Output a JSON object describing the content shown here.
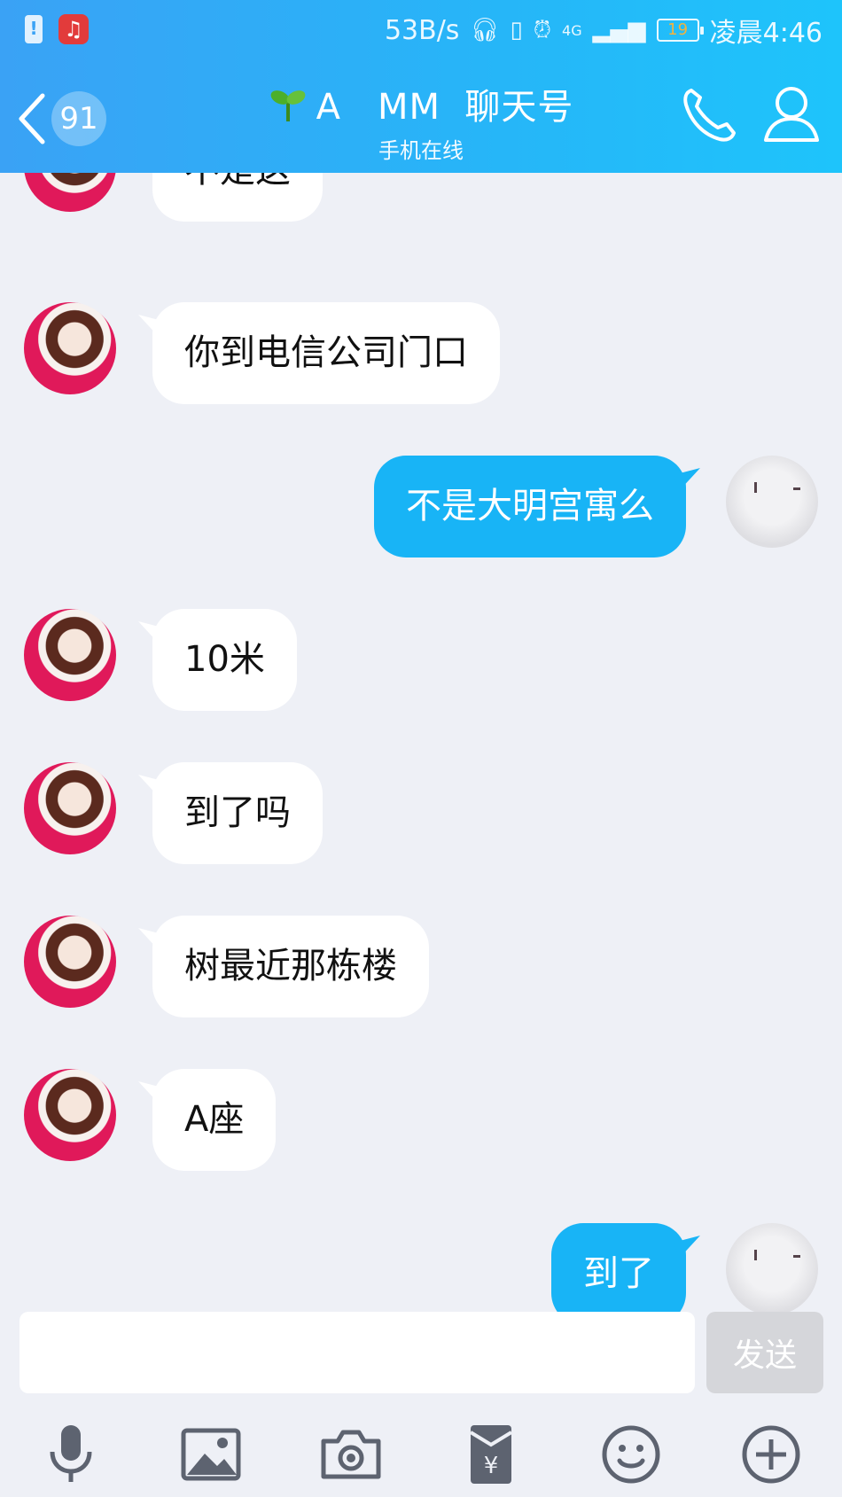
{
  "status_bar": {
    "net_speed": "53B/s",
    "signal_label": "4G",
    "battery_level": "19",
    "time": "凌晨4:46"
  },
  "nav": {
    "unread_count": "91",
    "title": "A　MM  聊天号",
    "subtitle": "手机在线"
  },
  "messages": [
    {
      "side": "in",
      "text": "不是这"
    },
    {
      "side": "in",
      "text": "你到电信公司门口"
    },
    {
      "side": "out",
      "text": "不是大明宫寓么"
    },
    {
      "side": "in",
      "text": "10米"
    },
    {
      "side": "in",
      "text": "到了吗"
    },
    {
      "side": "in",
      "text": "树最近那栋楼"
    },
    {
      "side": "in",
      "text": "A座"
    },
    {
      "side": "out",
      "text": "到了"
    }
  ],
  "composer": {
    "input_value": "",
    "send_label": "发送"
  },
  "toolbar_icons": [
    "microphone-icon",
    "image-icon",
    "camera-icon",
    "red-packet-icon",
    "emoji-icon",
    "plus-icon"
  ],
  "colors": {
    "header_start": "#3aa2f5",
    "header_end": "#1ec4fb",
    "outgoing_bubble": "#18b4f6",
    "incoming_bubble": "#ffffff",
    "background": "#eef0f6",
    "icon_gray": "#5d6370"
  }
}
